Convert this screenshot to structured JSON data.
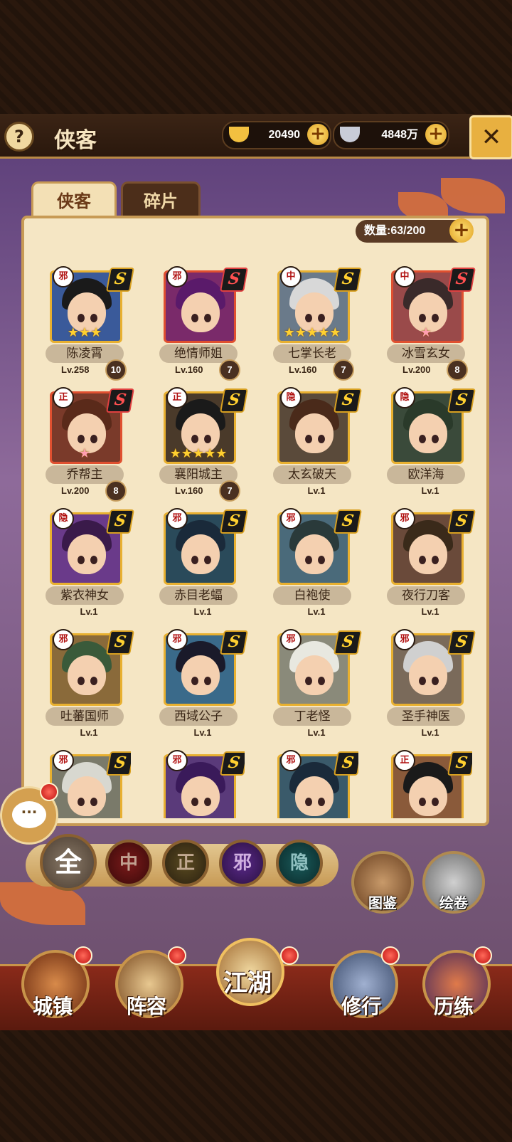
{
  "header": {
    "help": "?",
    "title": "侠客",
    "gold": "20490",
    "silver": "4848万",
    "close": "✕"
  },
  "tabs": [
    {
      "label": "侠客",
      "active": true
    },
    {
      "label": "碎片",
      "active": false
    }
  ],
  "capacity": "数量:63/200",
  "heroes": [
    {
      "name": "陈凌霄",
      "level": "Lv.258",
      "badge": "10",
      "faction": "邪",
      "rank": "S",
      "rank_color": "gold",
      "stars": "★★★",
      "star_type": "gold",
      "portrait_color": "#3a5a9a",
      "hair_color": "#1a1a1a"
    },
    {
      "name": "绝情师姐",
      "level": "Lv.160",
      "badge": "7",
      "faction": "邪",
      "rank": "S",
      "rank_color": "red",
      "stars": "",
      "star_type": "none",
      "portrait_color": "#7a2a6a",
      "hair_color": "#5a1a6a"
    },
    {
      "name": "七掌长老",
      "level": "Lv.160",
      "badge": "7",
      "faction": "中",
      "rank": "S",
      "rank_color": "gold",
      "stars": "★★★★★",
      "star_type": "gold",
      "portrait_color": "#6a7a8a",
      "hair_color": "#d8d8d8"
    },
    {
      "name": "冰雪玄女",
      "level": "Lv.200",
      "badge": "8",
      "faction": "中",
      "rank": "S",
      "rank_color": "red",
      "stars": "★",
      "star_type": "pink",
      "portrait_color": "#9a4a4a",
      "hair_color": "#3a2a2a"
    },
    {
      "name": "乔帮主",
      "level": "Lv.200",
      "badge": "8",
      "faction": "正",
      "rank": "S",
      "rank_color": "red",
      "stars": "★",
      "star_type": "pink",
      "portrait_color": "#7a3a2a",
      "hair_color": "#5a2a1a"
    },
    {
      "name": "襄阳城主",
      "level": "Lv.160",
      "badge": "7",
      "faction": "正",
      "rank": "S",
      "rank_color": "gold",
      "stars": "★★★★★",
      "star_type": "gold",
      "portrait_color": "#4a3a2a",
      "hair_color": "#1a1a1a"
    },
    {
      "name": "太玄破天",
      "level": "Lv.1",
      "badge": "",
      "faction": "隐",
      "rank": "S",
      "rank_color": "gold",
      "stars": "",
      "star_type": "none",
      "portrait_color": "#5a4a3a",
      "hair_color": "#4a2a1a"
    },
    {
      "name": "欧洋海",
      "level": "Lv.1",
      "badge": "",
      "faction": "隐",
      "rank": "S",
      "rank_color": "gold",
      "stars": "",
      "star_type": "none",
      "portrait_color": "#3a4a3a",
      "hair_color": "#2a3a2a"
    },
    {
      "name": "紫衣神女",
      "level": "Lv.1",
      "badge": "",
      "faction": "隐",
      "rank": "S",
      "rank_color": "gold",
      "stars": "",
      "star_type": "none",
      "portrait_color": "#6a3a8a",
      "hair_color": "#3a1a4a"
    },
    {
      "name": "赤目老蝠",
      "level": "Lv.1",
      "badge": "",
      "faction": "邪",
      "rank": "S",
      "rank_color": "gold",
      "stars": "",
      "star_type": "none",
      "portrait_color": "#2a4a5a",
      "hair_color": "#1a2a3a"
    },
    {
      "name": "白袍使",
      "level": "Lv.1",
      "badge": "",
      "faction": "邪",
      "rank": "S",
      "rank_color": "gold",
      "stars": "",
      "star_type": "none",
      "portrait_color": "#4a6a7a",
      "hair_color": "#2a3a3a"
    },
    {
      "name": "夜行刀客",
      "level": "Lv.1",
      "badge": "",
      "faction": "邪",
      "rank": "S",
      "rank_color": "gold",
      "stars": "",
      "star_type": "none",
      "portrait_color": "#6a4a3a",
      "hair_color": "#3a2a1a"
    },
    {
      "name": "吐蕃国师",
      "level": "Lv.1",
      "badge": "",
      "faction": "邪",
      "rank": "S",
      "rank_color": "gold",
      "stars": "",
      "star_type": "none",
      "portrait_color": "#8a6a3a",
      "hair_color": "#3a5a3a"
    },
    {
      "name": "西域公子",
      "level": "Lv.1",
      "badge": "",
      "faction": "邪",
      "rank": "S",
      "rank_color": "gold",
      "stars": "",
      "star_type": "none",
      "portrait_color": "#3a6a8a",
      "hair_color": "#1a1a2a"
    },
    {
      "name": "丁老怪",
      "level": "Lv.1",
      "badge": "",
      "faction": "邪",
      "rank": "S",
      "rank_color": "gold",
      "stars": "",
      "star_type": "none",
      "portrait_color": "#8a8a7a",
      "hair_color": "#e8e8e0"
    },
    {
      "name": "圣手神医",
      "level": "Lv.1",
      "badge": "",
      "faction": "邪",
      "rank": "S",
      "rank_color": "gold",
      "stars": "",
      "star_type": "none",
      "portrait_color": "#7a6a5a",
      "hair_color": "#d0d0d0"
    },
    {
      "name": "",
      "level": "",
      "badge": "",
      "faction": "邪",
      "rank": "S",
      "rank_color": "gold",
      "stars": "",
      "star_type": "none",
      "portrait_color": "#7a7a6a",
      "hair_color": "#d8d8d0"
    },
    {
      "name": "",
      "level": "",
      "badge": "",
      "faction": "邪",
      "rank": "S",
      "rank_color": "gold",
      "stars": "",
      "star_type": "none",
      "portrait_color": "#5a3a7a",
      "hair_color": "#3a1a5a"
    },
    {
      "name": "",
      "level": "",
      "badge": "",
      "faction": "邪",
      "rank": "S",
      "rank_color": "gold",
      "stars": "",
      "star_type": "none",
      "portrait_color": "#3a5a6a",
      "hair_color": "#1a2a3a"
    },
    {
      "name": "",
      "level": "",
      "badge": "",
      "faction": "正",
      "rank": "S",
      "rank_color": "gold",
      "stars": "",
      "star_type": "none",
      "portrait_color": "#8a5a3a",
      "hair_color": "#1a1a1a"
    }
  ],
  "filters": [
    "全",
    "中",
    "正",
    "邪",
    "隐"
  ],
  "side_buttons": {
    "atlas": "图鉴",
    "scroll": "绘卷"
  },
  "chat": "···",
  "nav": [
    "城镇",
    "阵容",
    "江湖",
    "修行",
    "历练"
  ]
}
